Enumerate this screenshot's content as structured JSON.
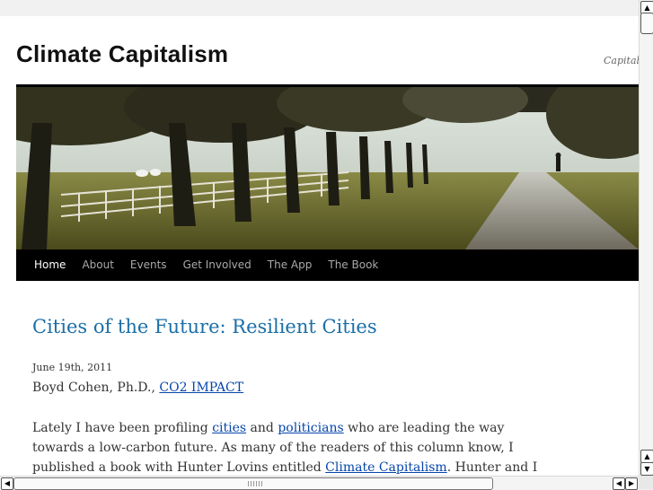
{
  "site": {
    "title": "Climate Capitalism",
    "description": "Capitalism"
  },
  "nav": {
    "items": [
      "Home",
      "About",
      "Events",
      "Get Involved",
      "The App",
      "The Book"
    ],
    "active": "Home"
  },
  "post": {
    "title": "Cities of the Future: Resilient Cities",
    "date": "June 19th, 2011",
    "author_prefix": "Boyd Cohen, Ph.D., ",
    "author_link": "CO2 IMPACT",
    "body": {
      "t1": "Lately I have been profiling ",
      "link1": "cities",
      "t2": " and ",
      "link2": "politicians",
      "t3": " who are leading the way towards a low-carbon future.  As many of the readers of this column know, I published a book with Hunter Lovins entitled ",
      "link3": "Climate Capitalism",
      "t4": ".  Hunter and I were disappointed about the lack of"
    }
  },
  "scrollbars": {
    "up_icon": "▲",
    "down_icon": "▼",
    "left_icon": "◀",
    "right_icon": "▶"
  },
  "colors": {
    "link": "#0645ad",
    "post_title": "#1b6fa8",
    "nav_bg": "#000000"
  }
}
